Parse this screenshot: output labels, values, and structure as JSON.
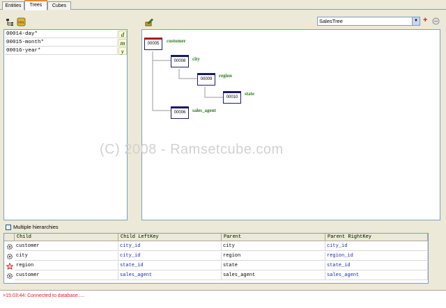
{
  "tabs": [
    {
      "label": "Entities",
      "active": false
    },
    {
      "label": "Trees",
      "active": true
    },
    {
      "label": "Cubes",
      "active": false
    }
  ],
  "left_icons": [
    "tree-hierarchy-icon",
    "xml-icon"
  ],
  "levels": [
    {
      "name": "00014-day*",
      "badge": "d"
    },
    {
      "name": "00015-month*",
      "badge": "m"
    },
    {
      "name": "00016-year*",
      "badge": "y"
    }
  ],
  "canvas_toolbar": {
    "icon": "edit-icon"
  },
  "tree_select": {
    "value": "SalesTree"
  },
  "tree": {
    "nodes": [
      {
        "id": "00005",
        "label": "customer",
        "root": true
      },
      {
        "id": "00008",
        "label": "city"
      },
      {
        "id": "00009",
        "label": "region"
      },
      {
        "id": "00010",
        "label": "state"
      },
      {
        "id": "00006",
        "label": "sales_agent"
      }
    ],
    "watermark": "(C) 2008 - Ramsetcube.com"
  },
  "multiple_hierarchies": {
    "label": "Multiple hierarchies",
    "checked": false
  },
  "grid": {
    "columns": [
      "Child",
      "Child LeftKey",
      "Parent",
      "Parent RightKey"
    ],
    "rows": [
      {
        "icon": "gear-icon",
        "child": "customer",
        "child_left_key": "city_id",
        "parent": "city",
        "parent_right_key": "city_id"
      },
      {
        "icon": "gear-icon",
        "child": "city",
        "child_left_key": "city_id",
        "parent": "region",
        "parent_right_key": "region_id"
      },
      {
        "icon": "star-icon",
        "child": "region",
        "child_left_key": "state_id",
        "parent": "state",
        "parent_right_key": "state_id"
      },
      {
        "icon": "gear-icon",
        "child": "customer",
        "child_left_key": "sales_agent",
        "parent": "sales_agent",
        "parent_right_key": "sales_agent"
      }
    ]
  },
  "log": {
    "message": ">15:03:44: Connected to database....."
  },
  "colors": {
    "link_key": "#1c2ab0",
    "node_label": "#2b7a1c",
    "root_border": "#b01818",
    "log_text": "#e02020"
  }
}
